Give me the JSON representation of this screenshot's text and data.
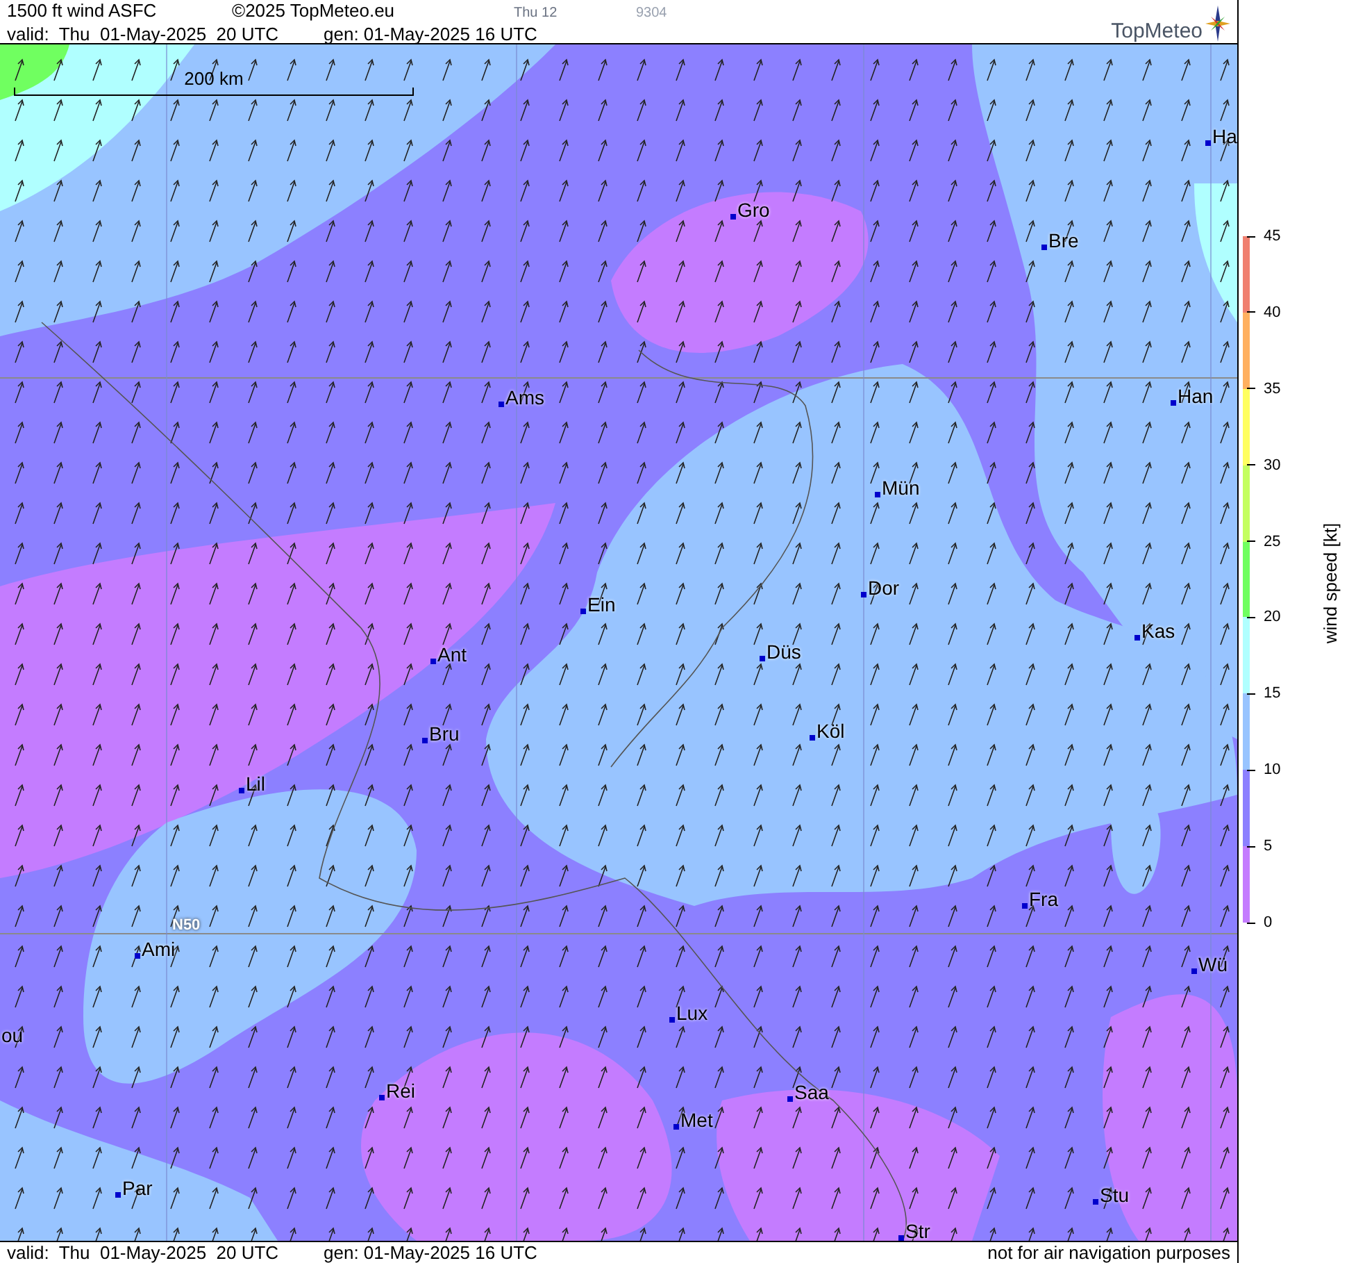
{
  "header": {
    "title": "1500 ft wind ASFC",
    "copyright": "©2025 TopMeteo.eu",
    "forecast_step": "Thu 12",
    "run_code": "9304",
    "valid": "valid:  Thu  01-May-2025  20 UTC",
    "generated": "gen: 01-May-2025 16 UTC",
    "logo": "TopMeteo"
  },
  "map": {
    "scale_label": "200 km",
    "latitude_label": "N50",
    "cities": [
      {
        "name": "Ha"
      },
      {
        "name": "Gro"
      },
      {
        "name": "Bre"
      },
      {
        "name": "Ams"
      },
      {
        "name": "Han"
      },
      {
        "name": "Mün"
      },
      {
        "name": "Dor"
      },
      {
        "name": "Ein"
      },
      {
        "name": "Kas"
      },
      {
        "name": "Düs"
      },
      {
        "name": "Ant"
      },
      {
        "name": "Köl"
      },
      {
        "name": "Bru"
      },
      {
        "name": "Lil"
      },
      {
        "name": "Fra"
      },
      {
        "name": "Ami"
      },
      {
        "name": "Wü"
      },
      {
        "name": "Lux"
      },
      {
        "name": "ou"
      },
      {
        "name": "Rei"
      },
      {
        "name": "Saa"
      },
      {
        "name": "Met"
      },
      {
        "name": "Par"
      },
      {
        "name": "Stu"
      },
      {
        "name": "Str"
      }
    ]
  },
  "legend": {
    "label": "wind speed [kt]",
    "ticks": [
      "45",
      "40",
      "35",
      "30",
      "25",
      "20",
      "15",
      "10",
      "5",
      "0"
    ],
    "bands": [
      {
        "color": "#f08070"
      },
      {
        "color": "#ffb060"
      },
      {
        "color": "#ffff60"
      },
      {
        "color": "#c4ff60"
      },
      {
        "color": "#70ff60"
      },
      {
        "color": "#b0ffff"
      },
      {
        "color": "#98c4ff"
      },
      {
        "color": "#8c80ff"
      },
      {
        "color": "#c47cff"
      }
    ]
  },
  "footer": {
    "valid": "valid:  Thu  01-May-2025  20 UTC",
    "generated": "gen: 01-May-2025 16 UTC",
    "disclaimer": "not for air navigation purposes"
  }
}
